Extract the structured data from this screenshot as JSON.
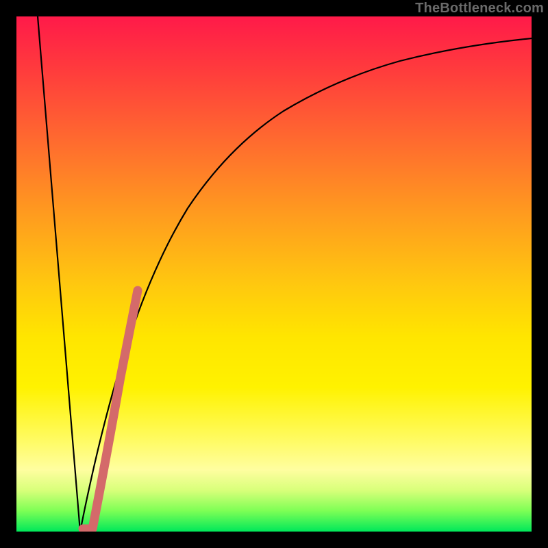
{
  "attribution": "TheBottleneck.com",
  "colors": {
    "background": "#000000",
    "curve_stroke": "#000000",
    "highlight_stroke": "#d46a6a"
  },
  "chart_data": {
    "type": "line",
    "title": "",
    "xlabel": "",
    "ylabel": "",
    "xlim": [
      0,
      100
    ],
    "ylim": [
      0,
      100
    ],
    "series": [
      {
        "name": "left-descending-line",
        "x": [
          4.2,
          12.4
        ],
        "y": [
          100,
          0
        ]
      },
      {
        "name": "right-rising-curve",
        "x": [
          12.4,
          15,
          18,
          22,
          26,
          30,
          35,
          40,
          46,
          53,
          61,
          70,
          80,
          90,
          100
        ],
        "y": [
          0,
          15,
          30,
          44,
          54,
          62,
          69,
          75,
          80,
          84,
          87.5,
          90.3,
          92.5,
          94.3,
          95.7
        ]
      },
      {
        "name": "highlight-segment",
        "x": [
          12.9,
          14.8,
          20.2,
          23.5
        ],
        "y": [
          0.5,
          0.5,
          30,
          47
        ]
      }
    ]
  }
}
